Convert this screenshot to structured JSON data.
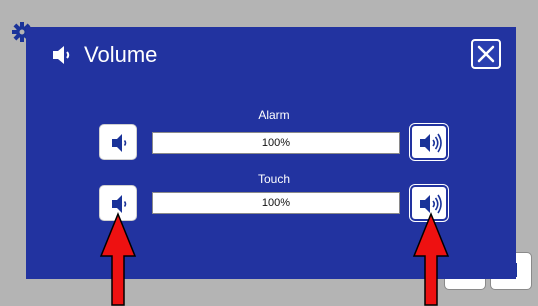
{
  "dialog": {
    "title": "Volume",
    "title_icon": "speaker-icon",
    "close_icon": "close-icon"
  },
  "rows": [
    {
      "label": "Alarm",
      "value_text": "100%",
      "level": 1.0
    },
    {
      "label": "Touch",
      "value_text": "100%",
      "level": 1.0
    }
  ],
  "icons": {
    "decrease": "speaker-low-icon",
    "increase": "speaker-high-icon",
    "background": "gear-icon"
  },
  "colors": {
    "dialog_bg": "#2233a0",
    "screen_bg": "#b4b4b4",
    "arrow": "#ee1111",
    "icon": "#1a3399"
  }
}
